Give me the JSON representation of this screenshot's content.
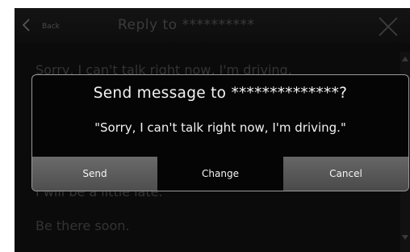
{
  "header": {
    "back_label": "Back",
    "title": "Reply to **********"
  },
  "messages": [
    "Sorry, I can't talk right now, I'm driving.",
    "I will be a little late.",
    "Be there soon."
  ],
  "dialog": {
    "title": "Send message to **************?",
    "message": "\"Sorry, I can't talk right now, I'm driving.\"",
    "buttons": {
      "send": "Send",
      "change": "Change",
      "cancel": "Cancel"
    }
  }
}
